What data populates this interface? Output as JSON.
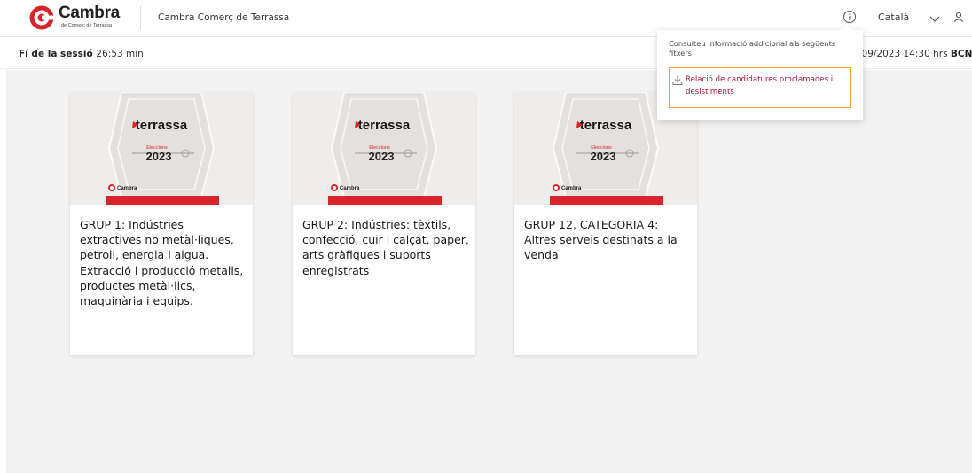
{
  "brand": {
    "name": "Cambra",
    "subtitle": "de Comerç de Terrassa",
    "accent": "#d7252b"
  },
  "header": {
    "org_name": "Cambra Comerç de Terrassa",
    "info_icon": "info-icon",
    "language": "Català",
    "chevron_icon": "chevron-down-icon",
    "user_icon": "user-icon"
  },
  "session": {
    "label": "Fí de la sessió",
    "time_left": "26:53 min",
    "date_text": "/09/2023 14:30 hrs",
    "zone": "BCN"
  },
  "card_image": {
    "logo_word": "terrassa",
    "elections_label": "Eleccions",
    "year": "2023",
    "footer_brand": "Cambra"
  },
  "cards": [
    {
      "title": "GRUP 1: Indústries extractives no metàl·liques, petroli, energia i aigua. Extracció i producció metalls, productes metàl·lics, maquinària i equips."
    },
    {
      "title": "GRUP 2: Indústries: tèxtils, confecció, cuir i calçat, paper, arts gràfiques i suports enregistrats"
    },
    {
      "title": "GRUP 12, CATEGORIA 4: Altres serveis destinats a la venda"
    }
  ],
  "dropdown": {
    "info_text": "Consulteu informació addicional als següents fitxers",
    "files": [
      {
        "label": "Relació de candidatures proclamades i desistiments",
        "icon": "download-icon",
        "highlight_color": "#f0a830"
      }
    ]
  }
}
